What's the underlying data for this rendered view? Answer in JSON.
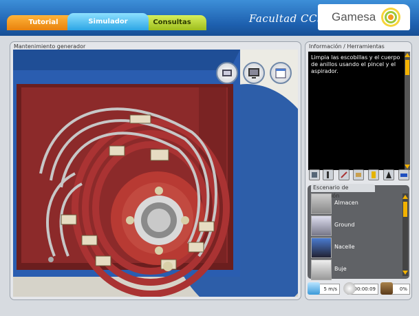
{
  "tabs": [
    {
      "label": "Tutorial"
    },
    {
      "label": "Simulador"
    },
    {
      "label": "Consultas"
    }
  ],
  "header": {
    "faculty": "Facultad CCS",
    "brand": "Gamesa"
  },
  "main_panel": {
    "title": "Mantenimiento generador",
    "view_buttons": [
      "zoom-view-icon",
      "monitor-view-icon",
      "calendar-view-icon"
    ]
  },
  "info_panel": {
    "title": "Información / Herramientas",
    "message": "Limpia las escobillas y el cuerpo de anillos usando el pincel y el aspirador."
  },
  "tools": [
    "tool-1-icon",
    "tool-2-icon",
    "tool-3-icon",
    "tool-4-icon",
    "tool-5-icon",
    "tool-6-icon",
    "tool-7-icon"
  ],
  "scenario": {
    "title": "Escenario de ubicación",
    "items": [
      {
        "label": "Almacen"
      },
      {
        "label": "Ground"
      },
      {
        "label": "Nacelle"
      },
      {
        "label": "Buje"
      }
    ]
  },
  "status": {
    "wind": "5 m/s",
    "time": "00:00:09",
    "progress": "0%"
  },
  "colors": {
    "tutorial": "#e9810d",
    "simulador": "#2ca6e6",
    "consultas": "#9dbd1d",
    "topbar": "#1d5fae"
  }
}
